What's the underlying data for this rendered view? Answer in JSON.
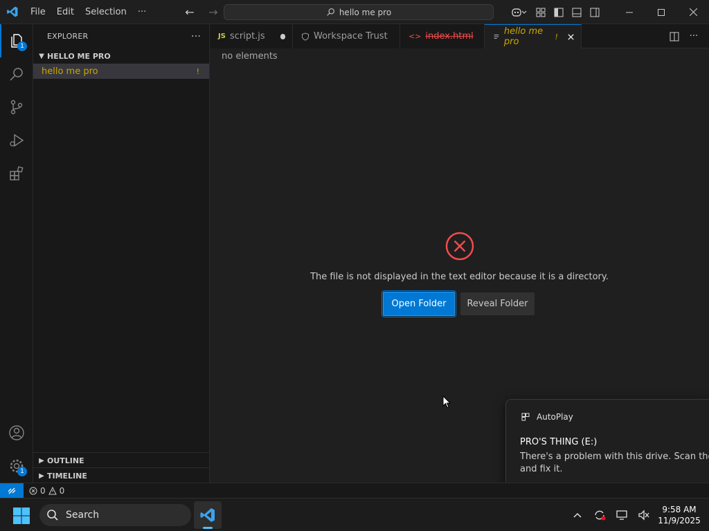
{
  "titlebar": {
    "menu": [
      "File",
      "Edit",
      "Selection",
      "···"
    ],
    "search_text": "hello me pro"
  },
  "activitybar": {
    "explorer_badge": "1",
    "manage_badge": "1"
  },
  "sidebar": {
    "title": "EXPLORER",
    "more": "···",
    "folder": "HELLO ME PRO",
    "file": "hello me pro",
    "file_status": "!",
    "outline": "OUTLINE",
    "timeline": "TIMELINE"
  },
  "tabs": [
    {
      "icon": "JS",
      "label": "script.js"
    },
    {
      "label": "Workspace Trust"
    },
    {
      "label": "index.html"
    },
    {
      "label": "hello me pro",
      "status": "!"
    }
  ],
  "editor": {
    "breadcrumb": "no elements",
    "message": "The file is not displayed in the text editor because it is a directory.",
    "open_folder": "Open Folder",
    "reveal_folder": "Reveal Folder"
  },
  "toast": {
    "app": "AutoPlay",
    "title": "PRO'S THING (E:)",
    "body_line1": "There's a problem with this drive.  Scan the drive now",
    "body_line2": "and fix it."
  },
  "statusbar": {
    "errors": "0",
    "warnings": "0"
  },
  "taskbar": {
    "search_label": "Search",
    "time": "9:58 AM",
    "date": "11/9/2025"
  },
  "colors": {
    "accent": "#0078d4",
    "warning_text": "#cca700",
    "error_red": "#f14c4c"
  }
}
